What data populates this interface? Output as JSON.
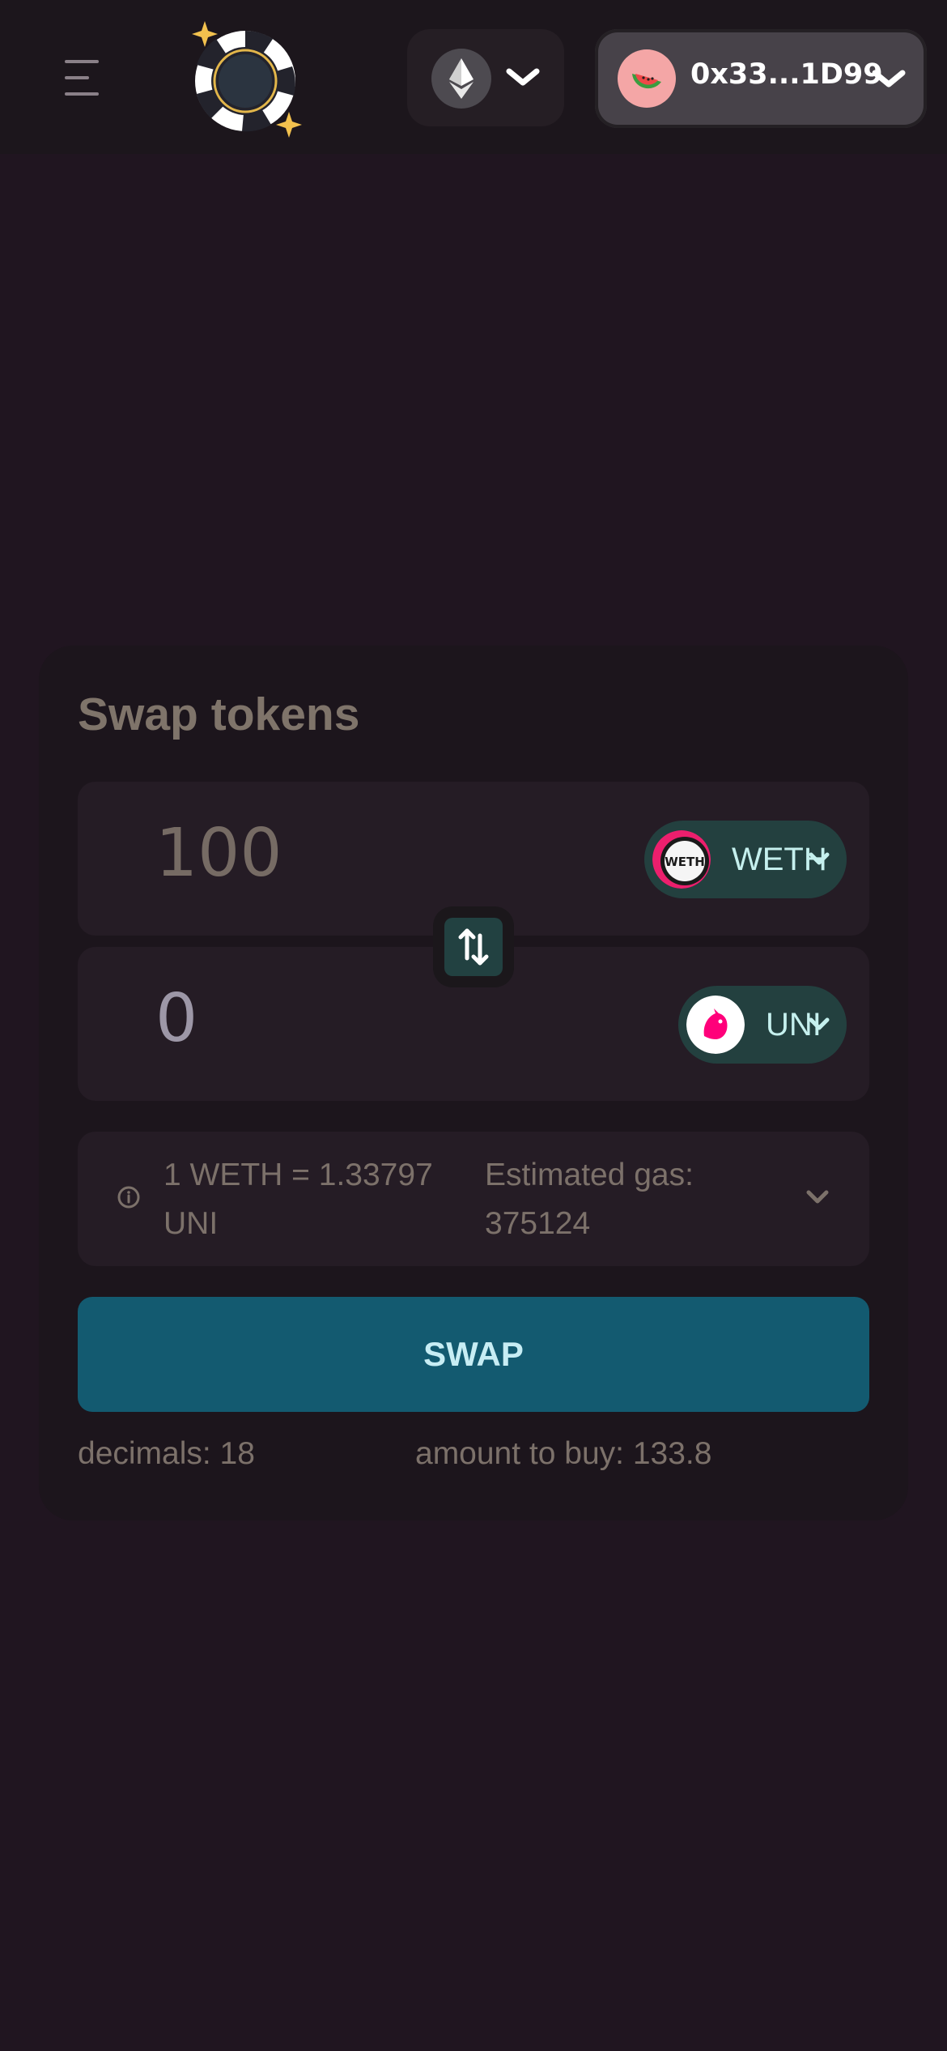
{
  "header": {
    "menu_icon": "menu-icon",
    "logo_icon": "poker-chip-logo",
    "network": {
      "icon": "ethereum-icon",
      "chevron": "chevron-down-icon"
    },
    "wallet": {
      "address": "0x33...1D99",
      "avatar_icon": "watermelon-icon",
      "chevron": "chevron-down-icon"
    }
  },
  "swap": {
    "title": "Swap tokens",
    "from": {
      "amount": "100",
      "token": "WETH",
      "logo_text": "WETH"
    },
    "to": {
      "amount": "0",
      "token": "UNI"
    },
    "switch_icon": "swap-arrows-icon",
    "rate": "1 WETH = 1.33797 UNI",
    "gas": "Estimated gas: 375124",
    "swap_label": "SWAP",
    "decimals": "decimals: 18",
    "amount_to_buy": "amount to buy: 133.8"
  },
  "colors": {
    "background": "#201520",
    "card": "#1c151c",
    "input_box": "#251c25",
    "token_pill": "#23403f",
    "swap_button": "#135a70",
    "accent_text": "#c5f0ee"
  }
}
